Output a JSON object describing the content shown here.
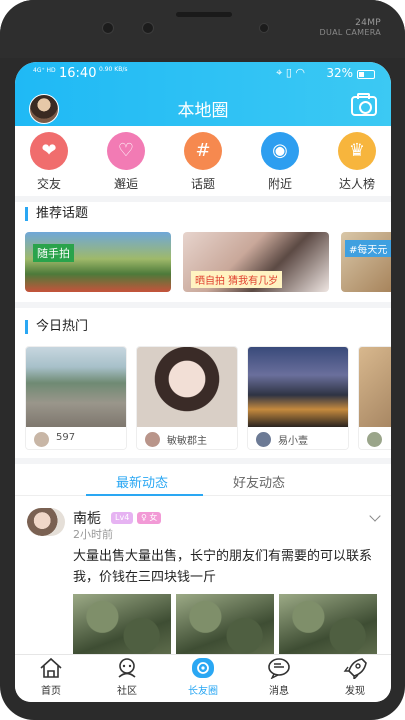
{
  "device": {
    "camera_label_top": "24MP",
    "camera_label_bottom": "DUAL CAMERA"
  },
  "status_bar": {
    "signal": "4G⁺ HD",
    "time": "16:40",
    "network_speed": "0.90 KB/s",
    "battery": "32%"
  },
  "header": {
    "title": "本地圈"
  },
  "quick_links": [
    {
      "label": "交友",
      "icon": "heart-icon",
      "color": "#f06d6d"
    },
    {
      "label": "邂逅",
      "icon": "heartbeat-icon",
      "color": "#f27bb4"
    },
    {
      "label": "话题",
      "icon": "hashtag-icon",
      "color": "#f6894f"
    },
    {
      "label": "附近",
      "icon": "location-icon",
      "color": "#2d9ef0"
    },
    {
      "label": "达人榜",
      "icon": "crown-icon",
      "color": "#f7b53d"
    }
  ],
  "topics": {
    "title": "推荐话题",
    "cards": [
      {
        "caption": "随手拍"
      },
      {
        "caption": "晒自拍 猜我有几岁"
      },
      {
        "caption": "#每天元"
      }
    ]
  },
  "hot": {
    "title": "今日热门",
    "cards": [
      {
        "name": "597"
      },
      {
        "name": "敏敏郡主"
      },
      {
        "name": "易小壹"
      },
      {
        "name": ""
      }
    ]
  },
  "feed_tabs": {
    "latest": "最新动态",
    "friends": "好友动态"
  },
  "post": {
    "author": "南栀",
    "badge_level": "Lv4",
    "badge_gender": "♀ 女",
    "time": "2小时前",
    "text": "大量出售大量出售，长宁的朋友们有需要的可以联系我，价钱在三四块钱一斤"
  },
  "bottom_nav": {
    "items": [
      {
        "label": "首页",
        "icon": "home-icon"
      },
      {
        "label": "社区",
        "icon": "community-icon"
      },
      {
        "label": "长友圈",
        "icon": "circle-icon"
      },
      {
        "label": "消息",
        "icon": "message-icon"
      },
      {
        "label": "发现",
        "icon": "rocket-icon"
      }
    ],
    "active_color": "#2aa7f3"
  }
}
